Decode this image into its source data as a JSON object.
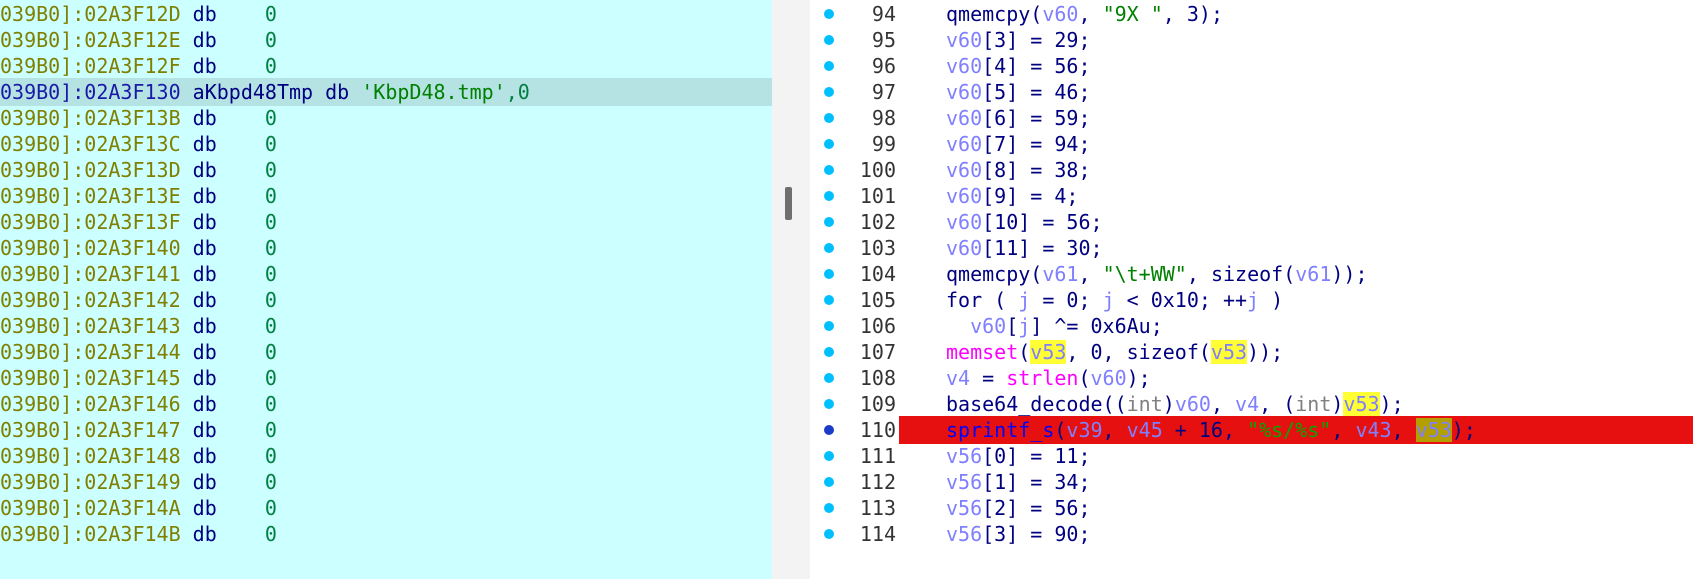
{
  "disassembly": {
    "rows": [
      {
        "addr": "039B0]:02A3F12D",
        "text": " db    0"
      },
      {
        "addr": "039B0]:02A3F12E",
        "text": " db    0"
      },
      {
        "addr": "039B0]:02A3F12F",
        "text": " db    0"
      },
      {
        "addr": "039B0]:02A3F130",
        "label": " aKbpd48Tmp db ",
        "string": "'KbpD48.tmp'",
        "tail": ",0",
        "selected": true
      },
      {
        "addr": "039B0]:02A3F13B",
        "text": " db    0"
      },
      {
        "addr": "039B0]:02A3F13C",
        "text": " db    0"
      },
      {
        "addr": "039B0]:02A3F13D",
        "text": " db    0"
      },
      {
        "addr": "039B0]:02A3F13E",
        "text": " db    0"
      },
      {
        "addr": "039B0]:02A3F13F",
        "text": " db    0"
      },
      {
        "addr": "039B0]:02A3F140",
        "text": " db    0"
      },
      {
        "addr": "039B0]:02A3F141",
        "text": " db    0"
      },
      {
        "addr": "039B0]:02A3F142",
        "text": " db    0"
      },
      {
        "addr": "039B0]:02A3F143",
        "text": " db    0"
      },
      {
        "addr": "039B0]:02A3F144",
        "text": " db    0"
      },
      {
        "addr": "039B0]:02A3F145",
        "text": " db    0"
      },
      {
        "addr": "039B0]:02A3F146",
        "text": " db    0"
      },
      {
        "addr": "039B0]:02A3F147",
        "text": " db    0"
      },
      {
        "addr": "039B0]:02A3F148",
        "text": " db    0"
      },
      {
        "addr": "039B0]:02A3F149",
        "text": " db    0"
      },
      {
        "addr": "039B0]:02A3F14A",
        "text": " db    0"
      },
      {
        "addr": "039B0]:02A3F14B",
        "text": " db    0"
      }
    ]
  },
  "pseudocode": {
    "lines": [
      {
        "n": "94",
        "tokens": [
          [
            "fn",
            "qmemcpy"
          ],
          [
            "txt",
            "("
          ],
          [
            "var",
            "v60"
          ],
          [
            "txt",
            ", "
          ],
          [
            "str",
            "\"9X \""
          ],
          [
            "txt",
            ", 3);"
          ]
        ]
      },
      {
        "n": "95",
        "tokens": [
          [
            "var",
            "v60"
          ],
          [
            "txt",
            "[3] = 29;"
          ]
        ]
      },
      {
        "n": "96",
        "tokens": [
          [
            "var",
            "v60"
          ],
          [
            "txt",
            "[4] = 56;"
          ]
        ]
      },
      {
        "n": "97",
        "tokens": [
          [
            "var",
            "v60"
          ],
          [
            "txt",
            "[5] = 46;"
          ]
        ]
      },
      {
        "n": "98",
        "tokens": [
          [
            "var",
            "v60"
          ],
          [
            "txt",
            "[6] = 59;"
          ]
        ]
      },
      {
        "n": "99",
        "tokens": [
          [
            "var",
            "v60"
          ],
          [
            "txt",
            "[7] = 94;"
          ]
        ]
      },
      {
        "n": "100",
        "tokens": [
          [
            "var",
            "v60"
          ],
          [
            "txt",
            "[8] = 38;"
          ]
        ]
      },
      {
        "n": "101",
        "tokens": [
          [
            "var",
            "v60"
          ],
          [
            "txt",
            "[9] = 4;"
          ]
        ]
      },
      {
        "n": "102",
        "tokens": [
          [
            "var",
            "v60"
          ],
          [
            "txt",
            "[10] = 56;"
          ]
        ]
      },
      {
        "n": "103",
        "tokens": [
          [
            "var",
            "v60"
          ],
          [
            "txt",
            "[11] = 30;"
          ]
        ]
      },
      {
        "n": "104",
        "tokens": [
          [
            "fn",
            "qmemcpy"
          ],
          [
            "txt",
            "("
          ],
          [
            "var",
            "v61"
          ],
          [
            "txt",
            ", "
          ],
          [
            "str",
            "\"\\t+WW\""
          ],
          [
            "txt",
            ", sizeof("
          ],
          [
            "var",
            "v61"
          ],
          [
            "txt",
            "));"
          ]
        ]
      },
      {
        "n": "105",
        "tokens": [
          [
            "txt",
            "for ( "
          ],
          [
            "var",
            "j"
          ],
          [
            "txt",
            " = 0; "
          ],
          [
            "var",
            "j"
          ],
          [
            "txt",
            " < 0x10; ++"
          ],
          [
            "var",
            "j"
          ],
          [
            "txt",
            " )"
          ]
        ]
      },
      {
        "n": "106",
        "tokens": [
          [
            "txt",
            "  "
          ],
          [
            "var",
            "v60"
          ],
          [
            "txt",
            "["
          ],
          [
            "var",
            "j"
          ],
          [
            "txt",
            "] ^= 0x6Au;"
          ]
        ]
      },
      {
        "n": "107",
        "tokens": [
          [
            "red",
            "memset"
          ],
          [
            "txt",
            "("
          ],
          [
            "hl",
            "v53"
          ],
          [
            "txt",
            ", 0, sizeof("
          ],
          [
            "hl",
            "v53"
          ],
          [
            "txt",
            "));"
          ]
        ]
      },
      {
        "n": "108",
        "tokens": [
          [
            "var",
            "v4"
          ],
          [
            "txt",
            " = "
          ],
          [
            "red",
            "strlen"
          ],
          [
            "txt",
            "("
          ],
          [
            "var",
            "v60"
          ],
          [
            "txt",
            ");"
          ]
        ]
      },
      {
        "n": "109",
        "tokens": [
          [
            "fn",
            "base64_decode"
          ],
          [
            "txt",
            "(("
          ],
          [
            "cast",
            "int"
          ],
          [
            "txt",
            ")"
          ],
          [
            "var",
            "v60"
          ],
          [
            "txt",
            ", "
          ],
          [
            "var",
            "v4"
          ],
          [
            "txt",
            ", ("
          ],
          [
            "cast",
            "int"
          ],
          [
            "txt",
            ")"
          ],
          [
            "hl",
            "v53"
          ],
          [
            "txt",
            ");"
          ]
        ]
      },
      {
        "n": "110",
        "breakpoint": true,
        "tokens": [
          [
            "bpfn",
            "sprintf_s"
          ],
          [
            "bptxt",
            "("
          ],
          [
            "bpvar",
            "v39"
          ],
          [
            "bptxt",
            ", "
          ],
          [
            "bpvar",
            "v45"
          ],
          [
            "bptxt",
            " + 16, "
          ],
          [
            "bpstr",
            "\"%s/%s\""
          ],
          [
            "bptxt",
            ", "
          ],
          [
            "bpvar",
            "v43"
          ],
          [
            "bptxt",
            ", "
          ],
          [
            "hldark",
            "v53"
          ],
          [
            "bptxt",
            ");"
          ]
        ]
      },
      {
        "n": "111",
        "tokens": [
          [
            "var",
            "v56"
          ],
          [
            "txt",
            "[0] = 11;"
          ]
        ]
      },
      {
        "n": "112",
        "tokens": [
          [
            "var",
            "v56"
          ],
          [
            "txt",
            "[1] = 34;"
          ]
        ]
      },
      {
        "n": "113",
        "tokens": [
          [
            "var",
            "v56"
          ],
          [
            "txt",
            "[2] = 56;"
          ]
        ]
      },
      {
        "n": "114",
        "tokens": [
          [
            "var",
            "v56"
          ],
          [
            "txt",
            "[3] = 90;"
          ]
        ]
      }
    ]
  }
}
